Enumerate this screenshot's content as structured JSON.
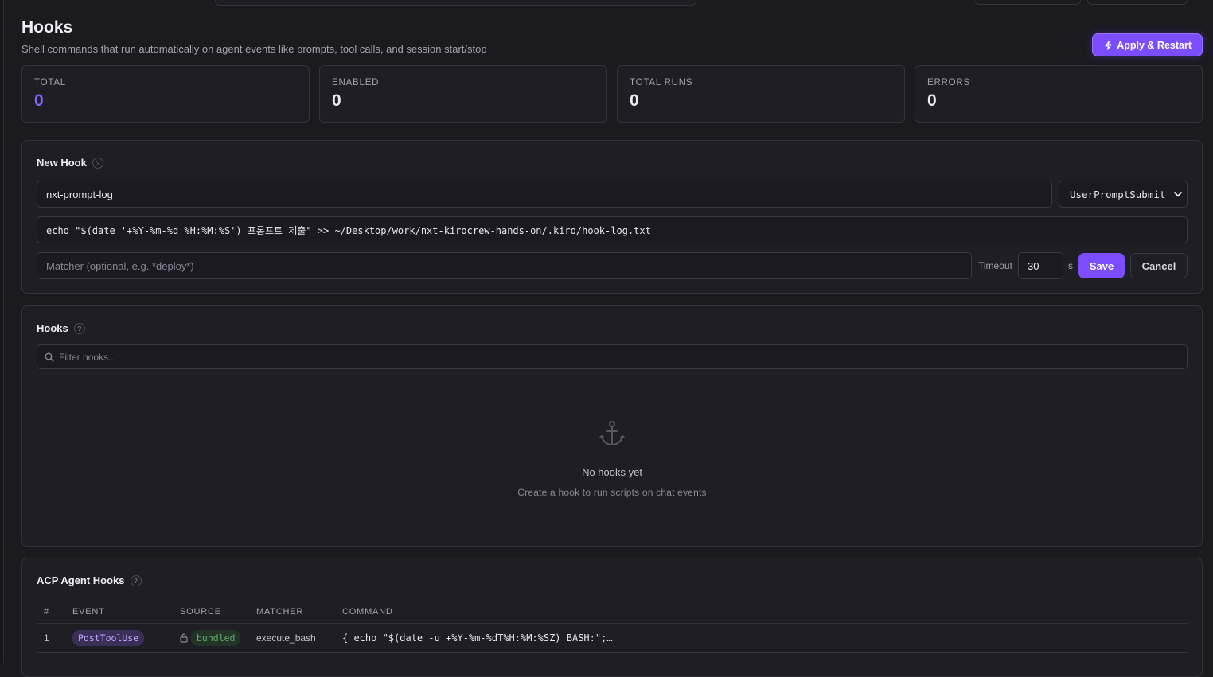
{
  "header": {
    "title": "Hooks",
    "subtitle": "Shell commands that run automatically on agent events like prompts, tool calls, and session start/stop",
    "apply_label": "Apply & Restart"
  },
  "stats": [
    {
      "label": "TOTAL",
      "value": "0"
    },
    {
      "label": "ENABLED",
      "value": "0"
    },
    {
      "label": "TOTAL RUNS",
      "value": "0"
    },
    {
      "label": "ERRORS",
      "value": "0"
    }
  ],
  "new_hook": {
    "title": "New Hook",
    "help": "?",
    "name_value": "nxt-prompt-log",
    "event_value": "UserPromptSubmit",
    "command_value": "echo \"$(date '+%Y-%m-%d %H:%M:%S') 프롬프트 제출\" >> ~/Desktop/work/nxt-kirocrew-hands-on/.kiro/hook-log.txt",
    "matcher_placeholder": "Matcher (optional, e.g. *deploy*)",
    "timeout_label": "Timeout",
    "timeout_value": "30",
    "timeout_unit": "s",
    "save_label": "Save",
    "cancel_label": "Cancel"
  },
  "hooks": {
    "title": "Hooks",
    "help": "?",
    "filter_placeholder": "Filter hooks...",
    "empty_title": "No hooks yet",
    "empty_subtitle": "Create a hook to run scripts on chat events"
  },
  "acp": {
    "title": "ACP Agent Hooks",
    "help": "?",
    "columns": [
      "#",
      "EVENT",
      "SOURCE",
      "MATCHER",
      "COMMAND"
    ],
    "rows": [
      {
        "num": "1",
        "event": "PostToolUse",
        "source": "bundled",
        "matcher": "execute_bash",
        "command": "{ echo \"$(date -u +%Y-%m-%dT%H:%M:%SZ) BASH:\";…"
      }
    ]
  },
  "colors": {
    "accent": "#7c4dff",
    "background": "#1b1a1f",
    "event_badge": "#3a2f57",
    "source_badge_text": "#5fae6e"
  }
}
